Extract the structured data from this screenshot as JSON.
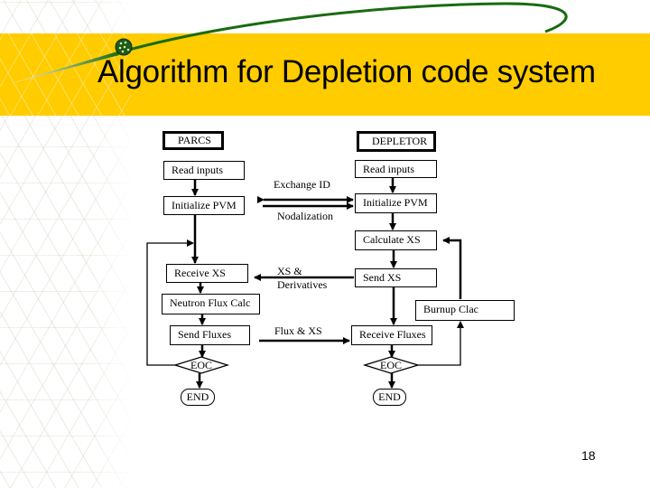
{
  "slide": {
    "title": "Algorithm for Depletion code system",
    "page_number": "18",
    "colors": {
      "band": "#ffcc00",
      "accent_curve": "#1a6b10",
      "text": "#000000"
    }
  },
  "diagram": {
    "left_column": {
      "header": "PARCS",
      "steps": [
        "Read inputs",
        "Initialize PVM",
        "Receive XS",
        "Neutron Flux Calc",
        "Send Fluxes"
      ],
      "decision": "EOC",
      "terminal": "END"
    },
    "right_column": {
      "header": "DEPLETOR",
      "steps": [
        "Read inputs",
        "Initialize PVM",
        "Calculate XS",
        "Send XS",
        "Receive Fluxes"
      ],
      "side_step": "Burnup Clac",
      "decision": "EOC",
      "terminal": "END"
    },
    "messages": {
      "exchange_id": "Exchange ID",
      "nodalization": "Nodalization",
      "xs_line1": "XS &",
      "xs_line2": "Derivatives",
      "flux_xs": "Flux & XS"
    }
  }
}
